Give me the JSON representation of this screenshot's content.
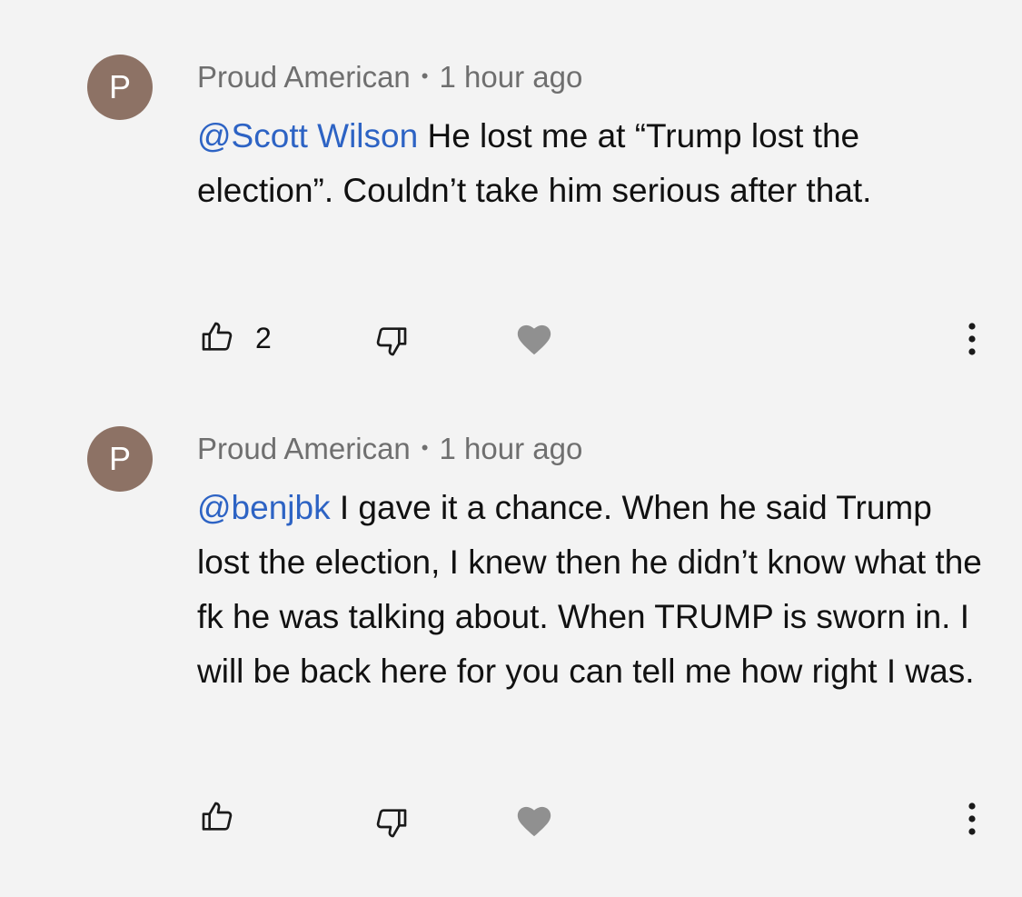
{
  "colors": {
    "background": "#f3f3f3",
    "avatar": "#8d7265",
    "mention": "#2d63c4",
    "text": "#111111",
    "meta": "#6f6f6f",
    "icon": "#1a1a1a",
    "heart": "#909090"
  },
  "comments": [
    {
      "avatar_letter": "P",
      "author": "Proud American",
      "separator": "•",
      "time": "1 hour ago",
      "mention": "@Scott Wilson",
      "text": " He lost me at “Trump lost the election”.   Couldn’t take him serious after that.",
      "likes": "2",
      "icons": [
        "thumbs-up-icon",
        "thumbs-down-icon",
        "heart-icon",
        "more-vert-icon"
      ]
    },
    {
      "avatar_letter": "P",
      "author": "Proud American",
      "separator": "•",
      "time": "1 hour ago",
      "mention": "@benjbk",
      "text": " I gave it a chance.   When he said Trump lost the election, I knew then he didn’t know what the fk he was talking about.  When TRUMP is sworn in. I will be back here for you can tell me how right I was.",
      "likes": "",
      "icons": [
        "thumbs-up-icon",
        "thumbs-down-icon",
        "heart-icon",
        "more-vert-icon"
      ]
    }
  ]
}
